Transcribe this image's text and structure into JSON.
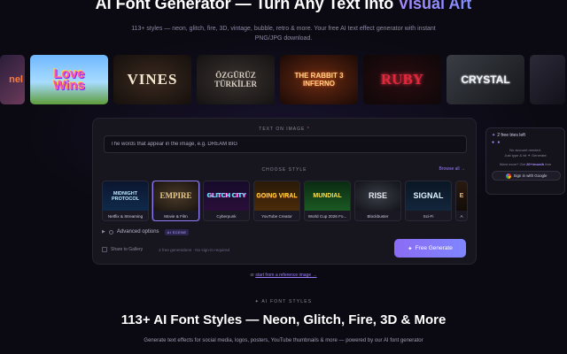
{
  "hero": {
    "title_main": "AI Font Generator — Turn Any Text Into ",
    "title_accent": "Visual Art",
    "subtitle": "113+ styles — neon, glitch, fire, 3D, vintage, bubble, retro & more. Your free AI text effect generator with instant PNG/JPG download."
  },
  "examples": [
    {
      "text": "nel"
    },
    {
      "text": "Love Wins"
    },
    {
      "text": "VINES"
    },
    {
      "text": "ÖZGÜRÜZ TÜRKİLER"
    },
    {
      "text": "THE RABBIT 3 INFERNO"
    },
    {
      "text": "RUBY"
    },
    {
      "text": "CRYSTAL"
    },
    {
      "text": ""
    }
  ],
  "form": {
    "text_label": "TEXT ON IMAGE",
    "required_mark": "*",
    "text_placeholder": "The words that appear in the image, e.g. DREAM BIG",
    "style_label": "CHOOSE STYLE",
    "browse_all": "Browse all →",
    "styles": [
      {
        "thumb": "MIDNIGHT PROTOCOL",
        "name": "Netflix & Streaming"
      },
      {
        "thumb": "EMPIRE",
        "name": "Movie & Film"
      },
      {
        "thumb": "GLITCH CITY",
        "name": "Cyberpunk"
      },
      {
        "thumb": "GOING VIRAL",
        "name": "YouTube Creator"
      },
      {
        "thumb": "MUNDIAL",
        "name": "World Cup 2026 Fo..."
      },
      {
        "thumb": "RISE",
        "name": "Blockbuster"
      },
      {
        "thumb": "SIGNAL",
        "name": "Sci-Fi"
      },
      {
        "thumb": "E",
        "name": "A"
      }
    ],
    "advanced_label": "Advanced options",
    "ai_badge": "AI SCENE",
    "share_label": "Share to Gallery",
    "quota_text": "2 free generations · No sign-in required",
    "generate_label": "Free Generate",
    "generate_icon": "✦"
  },
  "side": {
    "tries": "2 free tries left",
    "dots": "● ●",
    "no_account": "No account needed.",
    "just_type": "Just type & hit ✦ Generate",
    "want_more_pre": "Want more? Get ",
    "want_more_bold": "20+/month",
    "want_more_post": " free",
    "google_btn": "Sign in with Google"
  },
  "ref": {
    "prefix": "or ",
    "link": "start from a reference image →"
  },
  "section": {
    "label": "✦ AI FONT STYLES",
    "title": "113+ AI Font Styles — Neon, Glitch, Fire, 3D & More",
    "subtitle": "Generate text effects for social media, logos, posters, YouTube thumbnails & more — powered by our AI font generator"
  },
  "colors": {
    "accent": "#8b6cf4",
    "background": "#0b0a12",
    "panel": "#17161f"
  }
}
